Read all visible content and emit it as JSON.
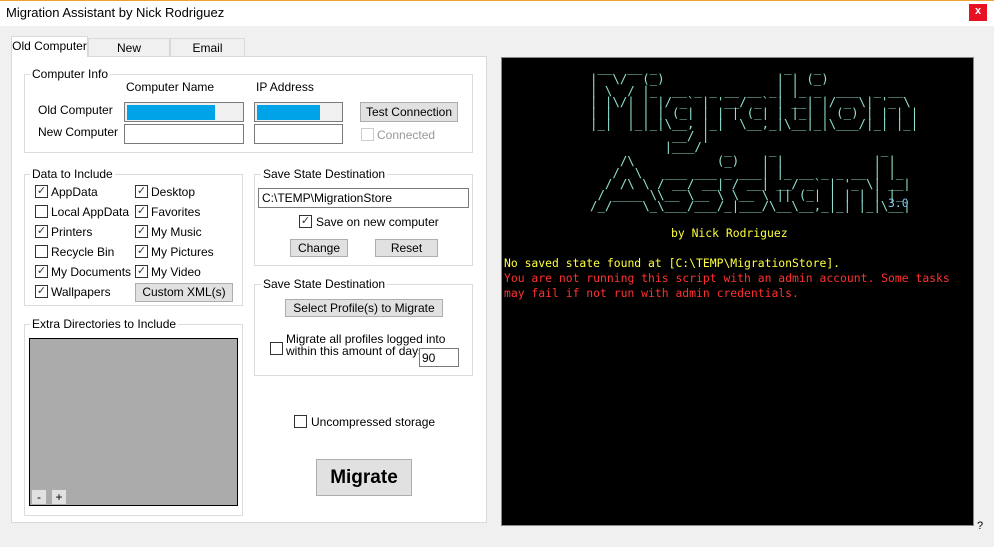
{
  "window": {
    "title": "Migration Assistant by Nick Rodriguez",
    "close": "x",
    "help": "?"
  },
  "tabs": [
    {
      "label": "Old Computer"
    },
    {
      "label": "New Computer"
    },
    {
      "label": "Email Settings"
    }
  ],
  "computer_info": {
    "title": "Computer Info",
    "col_name": "Computer Name",
    "col_ip": "IP Address",
    "old_label": "Old Computer",
    "new_label": "New Computer",
    "new_name": "",
    "new_ip": "",
    "test_button": "Test Connection",
    "connected_label": "Connected",
    "connected": false
  },
  "data_include": {
    "title": "Data to Include",
    "items": [
      {
        "label": "AppData",
        "checked": true
      },
      {
        "label": "Local AppData",
        "checked": false
      },
      {
        "label": "Printers",
        "checked": true
      },
      {
        "label": "Recycle Bin",
        "checked": false
      },
      {
        "label": "My Documents",
        "checked": true
      },
      {
        "label": "Wallpapers",
        "checked": true
      },
      {
        "label": "Desktop",
        "checked": true
      },
      {
        "label": "Favorites",
        "checked": true
      },
      {
        "label": "My Music",
        "checked": true
      },
      {
        "label": "My Pictures",
        "checked": true
      },
      {
        "label": "My Video",
        "checked": true
      }
    ],
    "custom_xml": "Custom XML(s)"
  },
  "save_state": {
    "title": "Save State Destination",
    "path": "C:\\TEMP\\MigrationStore",
    "save_on_new": "Save on new computer",
    "save_on_new_checked": true,
    "change": "Change",
    "reset": "Reset"
  },
  "profiles": {
    "title": "Save State Destination",
    "select": "Select Profile(s) to Migrate",
    "recent_line1": "Migrate all profiles logged into",
    "recent_line2": "within this amount of days:",
    "recent_checked": false,
    "days": "90"
  },
  "extra_dirs": {
    "title": "Extra Directories to Include",
    "remove": "-",
    "add": "+"
  },
  "uncompressed": {
    "label": "Uncompressed storage",
    "checked": false
  },
  "migrate": "Migrate",
  "console": {
    "art_line1": " __  __ _                 _   _             \n|  \\/  (_)               | | (_)            \n| \\  / |_  __ _ _ __ __ _| |_ _  ___  _ __  \n| |\\/| | |/ _` | '__/ _` | __| |/ _ \\| '_ \\ \n| |  | | | (_| | | | (_| | |_| | (_) | | | |\n|_|  |_|_|\\__, |_|  \\__,_|\\__|_|\\___/|_| |_|\n           __/ |                            \n          |___/                             ",
    "art_line2": "                  _     _              _   \n    /\\           (_)   | |            | |  \n   /  \\   ___ ___ _ ___| |_ __ _ _ __ | |_ \n  / /\\ \\ / __/ __| / __| __/ _` | '_ \\| __|\n / ____ \\\\__ \\__ \\ \\__ \\ || (_| | | | | |_ \n/_/    \\_\\___/___/_|___/\\__\\__,_|_| |_|\\__|",
    "version": "3.0",
    "byline": "by Nick Rodriguez",
    "msg_info": "No saved state found at [C:\\TEMP\\MigrationStore].",
    "msg_warn": "You are not running this script with an admin account. Some tasks\nmay fail if not run with admin credentials.",
    "colors": {
      "art": "#8fe0d0",
      "version": "#7fc8f0",
      "info": "#ffff40",
      "warn": "#ff3030"
    }
  }
}
